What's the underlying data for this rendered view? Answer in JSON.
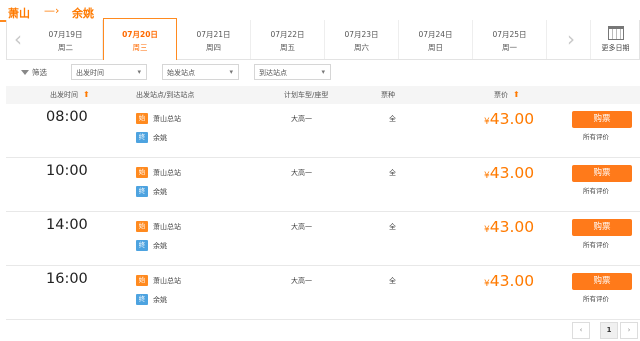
{
  "route": {
    "from": "萧山",
    "arrow": "—›",
    "to": "余姚"
  },
  "dates": [
    {
      "date": "07月19日",
      "weekday": "周二",
      "active": false
    },
    {
      "date": "07月20日",
      "weekday": "周三",
      "active": true
    },
    {
      "date": "07月21日",
      "weekday": "周四",
      "active": false
    },
    {
      "date": "07月22日",
      "weekday": "周五",
      "active": false
    },
    {
      "date": "07月23日",
      "weekday": "周六",
      "active": false
    },
    {
      "date": "07月24日",
      "weekday": "周日",
      "active": false
    },
    {
      "date": "07月25日",
      "weekday": "周一",
      "active": false
    }
  ],
  "nav": {
    "prev": "‹",
    "next": "›"
  },
  "more_dates": "更多日期",
  "filters": {
    "label": "筛选",
    "options": [
      {
        "value": "出发时间"
      },
      {
        "value": "始发站点"
      },
      {
        "value": "到达站点"
      }
    ],
    "chevron": "▾"
  },
  "table_headers": {
    "departure_time": "出发时间",
    "stations": "出发站点/到达站点",
    "vehicle": "计划车型/座型",
    "ticket_type": "票种",
    "price": "票价",
    "sort_icon": "⬆"
  },
  "trips": [
    {
      "time": "08:00",
      "start_tag": "始",
      "start": "萧山总站",
      "end_tag": "终",
      "end": "余姚",
      "vehicle": "大高一",
      "ticket": "全",
      "currency": "¥",
      "price": "43.00",
      "buy": "购票",
      "reviews": "所有评价"
    },
    {
      "time": "10:00",
      "start_tag": "始",
      "start": "萧山总站",
      "end_tag": "终",
      "end": "余姚",
      "vehicle": "大高一",
      "ticket": "全",
      "currency": "¥",
      "price": "43.00",
      "buy": "购票",
      "reviews": "所有评价"
    },
    {
      "time": "14:00",
      "start_tag": "始",
      "start": "萧山总站",
      "end_tag": "终",
      "end": "余姚",
      "vehicle": "大高一",
      "ticket": "全",
      "currency": "¥",
      "price": "43.00",
      "buy": "购票",
      "reviews": "所有评价"
    },
    {
      "time": "16:00",
      "start_tag": "始",
      "start": "萧山总站",
      "end_tag": "终",
      "end": "余姚",
      "vehicle": "大高一",
      "ticket": "全",
      "currency": "¥",
      "price": "43.00",
      "buy": "购票",
      "reviews": "所有评价"
    }
  ],
  "pagination": {
    "prev": "‹",
    "current": "1",
    "next": "›"
  },
  "colors": {
    "accent": "#ff7a00",
    "button": "#ff7a1a",
    "end_tag": "#4da3e0"
  }
}
